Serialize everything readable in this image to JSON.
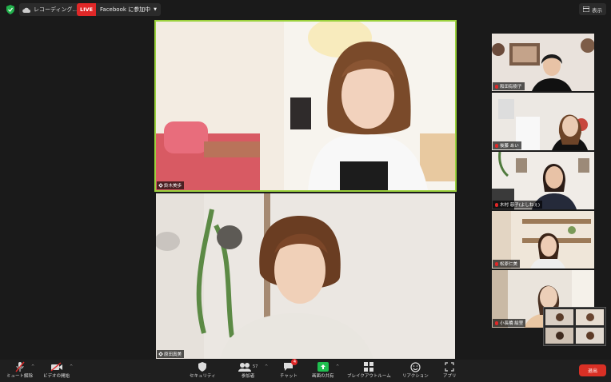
{
  "topbar": {
    "recording_label": "レコーディング...",
    "live_badge": "LIVE",
    "live_label": "Facebook に参加中",
    "view_label": "表示"
  },
  "speaker": {
    "name": "鈴木美歩"
  },
  "main_second": {
    "name": "原田真美"
  },
  "gallery": [
    {
      "name": "和田有樹子"
    },
    {
      "name": "後藤 あい"
    },
    {
      "name": "木村 慈子(よしねぇ)"
    },
    {
      "name": "松原仁美"
    },
    {
      "name": "小長橋 絵里"
    }
  ],
  "toolbar": {
    "mute_label": "ミュート解除",
    "video_label": "ビデオの開始",
    "security_label": "セキュリティ",
    "participants_label": "参加者",
    "participants_count": "57",
    "chat_label": "チャット",
    "chat_badge": "4",
    "share_label": "画面の共有",
    "breakout_label": "ブレイクアウトルーム",
    "reactions_label": "リアクション",
    "apps_label": "アプリ",
    "leave_label": "退出"
  },
  "colors": {
    "active_speaker_border": "#9bd13d",
    "live_red": "#e02828",
    "share_green": "#1fbf4f",
    "leave_red": "#d93025"
  }
}
